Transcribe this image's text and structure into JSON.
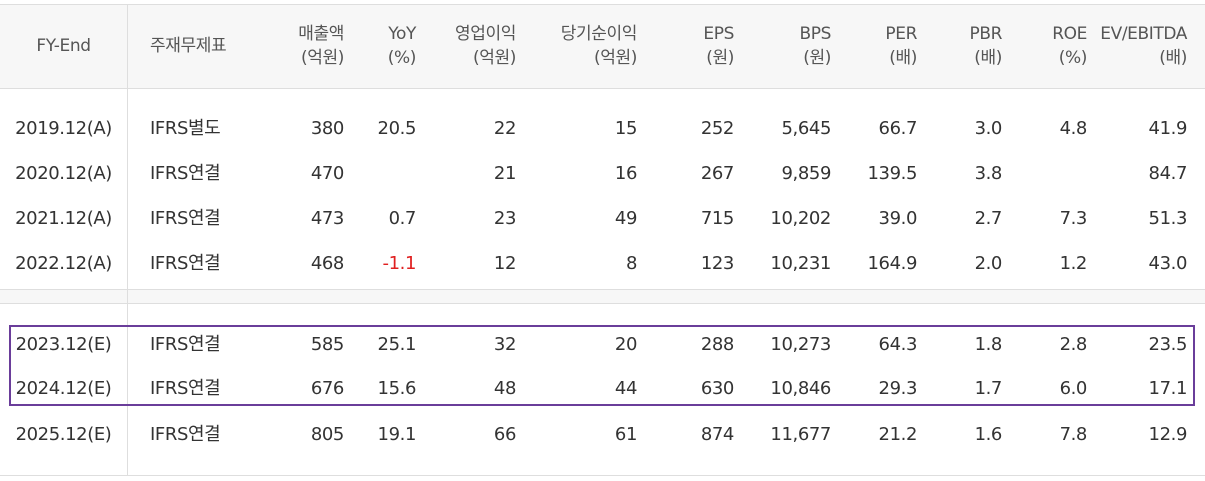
{
  "header": {
    "fy_end": "FY-End",
    "basis": "주재무제표",
    "revenue": [
      "매출액",
      "(억원)"
    ],
    "yoy": [
      "YoY",
      "(%)"
    ],
    "op_income": [
      "영업이익",
      "(억원)"
    ],
    "net_income": [
      "당기순이익",
      "(억원)"
    ],
    "eps": [
      "EPS",
      "(원)"
    ],
    "bps": [
      "BPS",
      "(원)"
    ],
    "per": [
      "PER",
      "(배)"
    ],
    "pbr": [
      "PBR",
      "(배)"
    ],
    "roe": [
      "ROE",
      "(%)"
    ],
    "ev_ebitda": [
      "EV/EBITDA",
      "(배)"
    ]
  },
  "rows": [
    {
      "fy": "2019.12(A)",
      "basis": "IFRS별도",
      "revenue": "380",
      "yoy": "20.5",
      "op": "22",
      "net": "15",
      "eps": "252",
      "bps": "5,645",
      "per": "66.7",
      "pbr": "3.0",
      "roe": "4.8",
      "ev": "41.9"
    },
    {
      "fy": "2020.12(A)",
      "basis": "IFRS연결",
      "revenue": "470",
      "yoy": "",
      "op": "21",
      "net": "16",
      "eps": "267",
      "bps": "9,859",
      "per": "139.5",
      "pbr": "3.8",
      "roe": "",
      "ev": "84.7"
    },
    {
      "fy": "2021.12(A)",
      "basis": "IFRS연결",
      "revenue": "473",
      "yoy": "0.7",
      "op": "23",
      "net": "49",
      "eps": "715",
      "bps": "10,202",
      "per": "39.0",
      "pbr": "2.7",
      "roe": "7.3",
      "ev": "51.3"
    },
    {
      "fy": "2022.12(A)",
      "basis": "IFRS연결",
      "revenue": "468",
      "yoy": "-1.1",
      "op": "12",
      "net": "8",
      "eps": "123",
      "bps": "10,231",
      "per": "164.9",
      "pbr": "2.0",
      "roe": "1.2",
      "ev": "43.0"
    },
    {
      "fy": "2023.12(E)",
      "basis": "IFRS연결",
      "revenue": "585",
      "yoy": "25.1",
      "op": "32",
      "net": "20",
      "eps": "288",
      "bps": "10,273",
      "per": "64.3",
      "pbr": "1.8",
      "roe": "2.8",
      "ev": "23.5"
    },
    {
      "fy": "2024.12(E)",
      "basis": "IFRS연결",
      "revenue": "676",
      "yoy": "15.6",
      "op": "48",
      "net": "44",
      "eps": "630",
      "bps": "10,846",
      "per": "29.3",
      "pbr": "1.7",
      "roe": "6.0",
      "ev": "17.1"
    },
    {
      "fy": "2025.12(E)",
      "basis": "IFRS연결",
      "revenue": "805",
      "yoy": "19.1",
      "op": "66",
      "net": "61",
      "eps": "874",
      "bps": "11,677",
      "per": "21.2",
      "pbr": "1.6",
      "roe": "7.8",
      "ev": "12.9"
    }
  ],
  "colors": {
    "negative": "#e02020",
    "highlight_border": "#6a3d9a"
  }
}
